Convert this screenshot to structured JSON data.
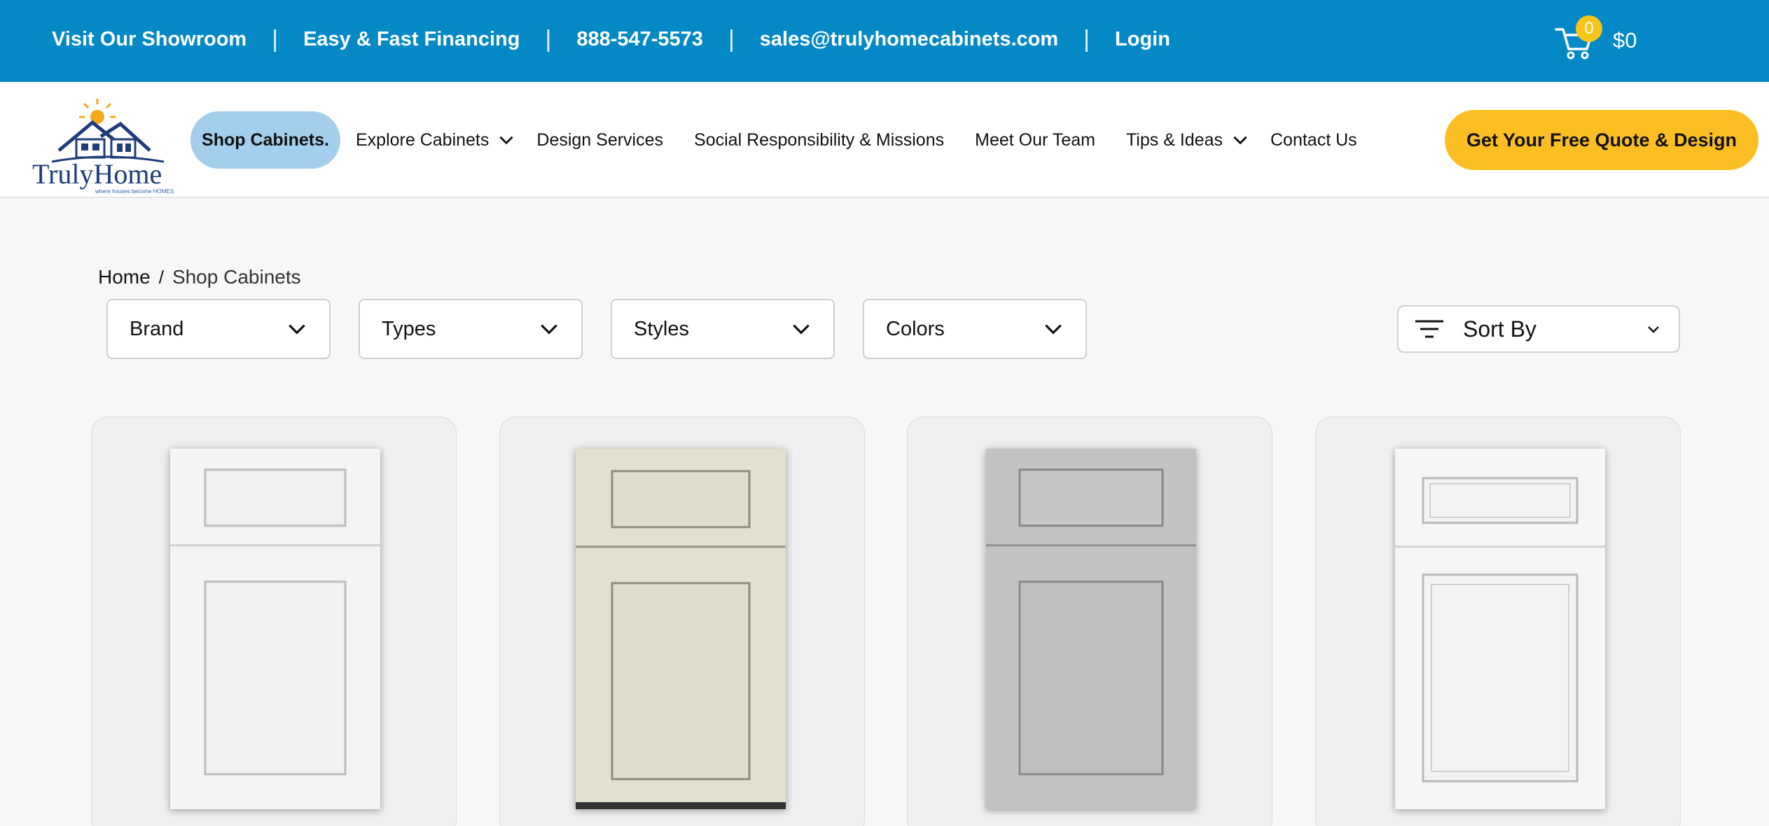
{
  "topbar": {
    "links": [
      "Visit Our Showroom",
      "Easy & Fast Financing",
      "888-547-5573",
      "sales@trulyhomecabinets.com",
      "Login"
    ],
    "separator": "|",
    "cart_count": "0",
    "cart_total": "$0",
    "background": "#0489c6"
  },
  "brand": {
    "name": "TrulyHome",
    "tagline": "where houses become HOMES"
  },
  "nav": {
    "active": "Shop Cabinets.",
    "items": [
      "Explore Cabinets",
      "Design Services",
      "Social Responsibility & Missions",
      "Meet Our Team",
      "Tips & Ideas",
      "Contact Us"
    ],
    "dropdown_items": [
      "Explore Cabinets",
      "Tips & Ideas"
    ],
    "cta": "Get Your Free Quote & Design",
    "cta_color": "#fbbf24",
    "active_color": "#a3cfec"
  },
  "breadcrumb": {
    "home": "Home",
    "separator": "/",
    "current": "Shop Cabinets"
  },
  "filters": [
    "Brand",
    "Types",
    "Styles",
    "Colors"
  ],
  "sort": {
    "label": "Sort By",
    "icon": "filter-lines-icon"
  },
  "products": [
    {
      "finish": "white shaker",
      "color": "#f4f4f4"
    },
    {
      "finish": "cream shaker",
      "color": "#e3e0cf"
    },
    {
      "finish": "gray shaker",
      "color": "#c2c2c2"
    },
    {
      "finish": "white raised panel",
      "color": "#f6f6f6"
    }
  ]
}
